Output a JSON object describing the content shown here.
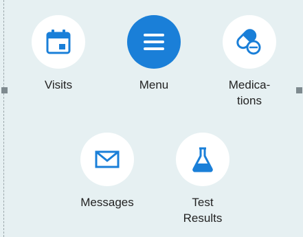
{
  "colors": {
    "background": "#e6f0f2",
    "accent": "#1a7fd8",
    "circle": "#ffffff"
  },
  "items": [
    {
      "label": "Visits",
      "icon": "calendar-icon"
    },
    {
      "label": "Menu",
      "icon": "hamburger-menu-icon",
      "active": true
    },
    {
      "label": "Medica-\ntions",
      "icon": "pills-icon"
    },
    {
      "label": "Messages",
      "icon": "envelope-icon"
    },
    {
      "label": "Test\nResults",
      "icon": "flask-icon"
    }
  ],
  "labels": {
    "visits": "Visits",
    "menu": "Menu",
    "medications_l1": "Medica-",
    "medications_l2": "tions",
    "messages": "Messages",
    "test_results_l1": "Test",
    "test_results_l2": "Results"
  }
}
